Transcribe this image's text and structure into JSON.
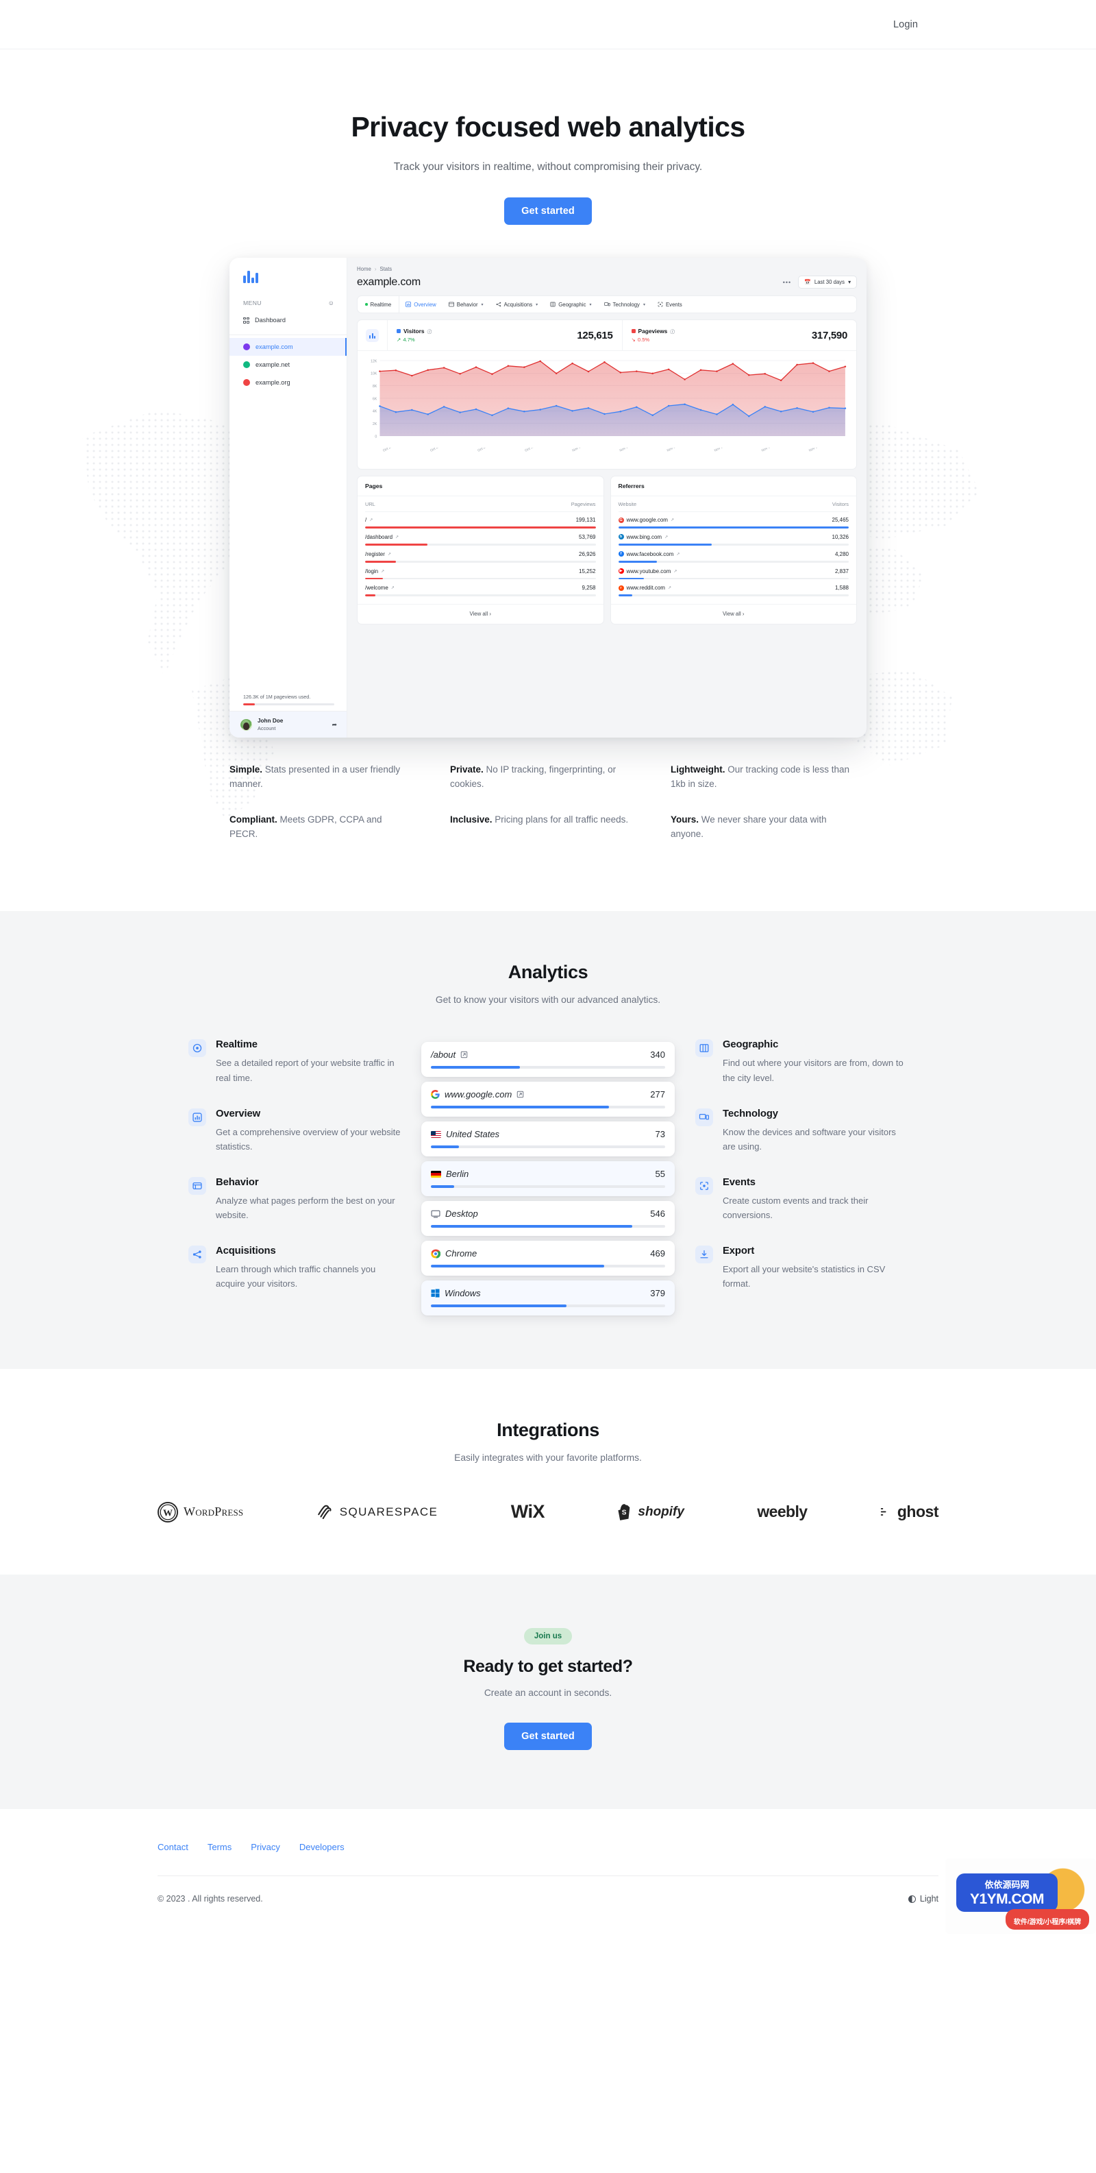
{
  "nav": {
    "login": "Login"
  },
  "hero": {
    "title": "Privacy focused web analytics",
    "subtitle": "Track your visitors in realtime, without compromising their privacy.",
    "cta": "Get started"
  },
  "dashboard": {
    "menu_label": "MENU",
    "nav_dashboard": "Dashboard",
    "sites": [
      {
        "name": "example.com",
        "active": true,
        "color": "#7c3aed"
      },
      {
        "name": "example.net",
        "active": false,
        "color": "#10b981"
      },
      {
        "name": "example.org",
        "active": false,
        "color": "#ef4444"
      }
    ],
    "quota_text": "126.3K of 1M pageviews used.",
    "account_name": "John Doe",
    "account_sub": "Account",
    "breadcrumb_home": "Home",
    "breadcrumb_current": "Stats",
    "site_title": "example.com",
    "dots": "•••",
    "date_range": "Last 30 days",
    "tabs": [
      {
        "label": "Realtime",
        "icon": "dot-green",
        "caret": false,
        "active": false
      },
      {
        "label": "Overview",
        "icon": "chart-icon",
        "caret": false,
        "active": true
      },
      {
        "label": "Behavior",
        "icon": "window-icon",
        "caret": true,
        "active": false
      },
      {
        "label": "Acquisitions",
        "icon": "share-icon",
        "caret": true,
        "active": false
      },
      {
        "label": "Geographic",
        "icon": "map-icon",
        "caret": true,
        "active": false
      },
      {
        "label": "Technology",
        "icon": "device-icon",
        "caret": true,
        "active": false
      },
      {
        "label": "Events",
        "icon": "target-icon",
        "caret": false,
        "active": false
      }
    ],
    "metrics": [
      {
        "name": "Visitors",
        "value": "125,615",
        "delta": "4.7%",
        "direction": "up",
        "color": "#3b82f6"
      },
      {
        "name": "Pageviews",
        "value": "317,590",
        "delta": "0.5%",
        "direction": "down",
        "color": "#ef4444"
      }
    ],
    "pages_card": {
      "title": "Pages",
      "col_label": "URL",
      "col_value": "Pageviews",
      "rows": [
        {
          "label": "/",
          "value": "199,131",
          "pct": 100
        },
        {
          "label": "/dashboard",
          "value": "53,769",
          "pct": 27
        },
        {
          "label": "/register",
          "value": "26,926",
          "pct": 13.5
        },
        {
          "label": "/login",
          "value": "15,252",
          "pct": 7.7
        },
        {
          "label": "/welcome",
          "value": "9,258",
          "pct": 4.6
        }
      ],
      "view_all": "View all"
    },
    "referrers_card": {
      "title": "Referrers",
      "col_label": "Website",
      "col_value": "Visitors",
      "rows": [
        {
          "label": "www.google.com",
          "value": "25,465",
          "pct": 100,
          "brand": "#ea4335",
          "letter": "G"
        },
        {
          "label": "www.bing.com",
          "value": "10,326",
          "pct": 40.5,
          "brand": "#0d7ec4",
          "letter": "b"
        },
        {
          "label": "www.facebook.com",
          "value": "4,280",
          "pct": 16.8,
          "brand": "#1877f2",
          "letter": "f"
        },
        {
          "label": "www.youtube.com",
          "value": "2,837",
          "pct": 11.1,
          "brand": "#ff0000",
          "letter": "▶"
        },
        {
          "label": "www.reddit.com",
          "value": "1,588",
          "pct": 6.2,
          "brand": "#ff4500",
          "letter": "r"
        }
      ],
      "view_all": "View all"
    },
    "chart_data": {
      "type": "area",
      "title": "",
      "xlabel": "",
      "ylabel": "",
      "ylim": [
        0,
        12000
      ],
      "yticks": [
        "0",
        "2K",
        "4K",
        "6K",
        "8K",
        "10K",
        "12K"
      ],
      "grid": true,
      "legend_position": "top",
      "x": [
        "Oct 22",
        "Oct 23",
        "Oct 24",
        "Oct 25",
        "Oct 26",
        "Oct 27",
        "Oct 28",
        "Oct 29",
        "Oct 30",
        "Oct 31",
        "Nov 1",
        "Nov 2",
        "Nov 3",
        "Nov 4",
        "Nov 5",
        "Nov 6",
        "Nov 7",
        "Nov 8",
        "Nov 9",
        "Nov 10",
        "Nov 11",
        "Nov 12",
        "Nov 13",
        "Nov 14",
        "Nov 15",
        "Nov 16",
        "Nov 17",
        "Nov 18",
        "Nov 19",
        "Nov 20"
      ],
      "xtick_labels": [
        "Oct 22",
        "Oct 25",
        "Oct 28",
        "Oct 31",
        "Nov 3",
        "Nov 6",
        "Nov 9",
        "Nov 12",
        "Nov 15",
        "Nov 18"
      ],
      "series": [
        {
          "name": "Pageviews",
          "color": "#e03131",
          "values": [
            10300,
            10450,
            9600,
            10500,
            10850,
            9900,
            10950,
            9850,
            11150,
            10950,
            11900,
            9950,
            11550,
            10250,
            11750,
            10100,
            10300,
            9950,
            10600,
            9000,
            10500,
            10300,
            11500,
            9700,
            9900,
            8850,
            11350,
            11600,
            10300,
            11050
          ]
        },
        {
          "name": "Visitors",
          "color": "#3b82f6",
          "values": [
            4750,
            3800,
            4150,
            3450,
            4650,
            3750,
            4250,
            3300,
            4400,
            3900,
            4200,
            4800,
            4000,
            4450,
            3500,
            3900,
            4600,
            3300,
            4800,
            5050,
            4150,
            3450,
            5000,
            3150,
            4650,
            3900,
            4450,
            3850,
            4500,
            4400
          ]
        }
      ]
    }
  },
  "blurbs": [
    {
      "lead": "Simple.",
      "text": " Stats presented in a user friendly manner."
    },
    {
      "lead": "Private.",
      "text": " No IP tracking, fingerprinting, or cookies."
    },
    {
      "lead": "Lightweight.",
      "text": " Our tracking code is less than 1kb in size."
    },
    {
      "lead": "Compliant.",
      "text": " Meets GDPR, CCPA and PECR."
    },
    {
      "lead": "Inclusive.",
      "text": " Pricing plans for all traffic needs."
    },
    {
      "lead": "Yours.",
      "text": " We never share your data with anyone."
    }
  ],
  "analytics": {
    "title": "Analytics",
    "subtitle": "Get to know your visitors with our advanced analytics.",
    "left_features": [
      {
        "icon": "realtime-icon",
        "title": "Realtime",
        "desc": "See a detailed report of your website traffic in real time."
      },
      {
        "icon": "overview-icon",
        "title": "Overview",
        "desc": "Get a comprehensive overview of your website statistics."
      },
      {
        "icon": "behavior-icon",
        "title": "Behavior",
        "desc": "Analyze what pages perform the best on your website."
      },
      {
        "icon": "acquisitions-icon",
        "title": "Acquisitions",
        "desc": "Learn through which traffic channels you acquire your visitors."
      }
    ],
    "right_features": [
      {
        "icon": "geographic-icon",
        "title": "Geographic",
        "desc": "Find out where your visitors are from, down to the city level."
      },
      {
        "icon": "technology-icon",
        "title": "Technology",
        "desc": "Know the devices and software your visitors are using."
      },
      {
        "icon": "events-icon",
        "title": "Events",
        "desc": "Create custom events and track their conversions."
      },
      {
        "icon": "export-icon",
        "title": "Export",
        "desc": "Export all your website's statistics in CSV format."
      }
    ],
    "stat_cards": [
      {
        "label": "/about",
        "value": "340",
        "pct": 38,
        "icon": "external-link-icon",
        "alt": false
      },
      {
        "label": "www.google.com",
        "value": "277",
        "pct": 76,
        "icon": "google-icon",
        "alt": false
      },
      {
        "label": "United States",
        "value": "73",
        "pct": 12,
        "icon": "flag-us-icon",
        "alt": false
      },
      {
        "label": "Berlin",
        "value": "55",
        "pct": 10,
        "icon": "flag-de-icon",
        "alt": true
      },
      {
        "label": "Desktop",
        "value": "546",
        "pct": 86,
        "icon": "monitor-icon",
        "alt": false
      },
      {
        "label": "Chrome",
        "value": "469",
        "pct": 74,
        "icon": "chrome-icon",
        "alt": false
      },
      {
        "label": "Windows",
        "value": "379",
        "pct": 58,
        "icon": "windows-icon",
        "alt": true
      }
    ]
  },
  "integrations": {
    "title": "Integrations",
    "subtitle": "Easily integrates with your favorite platforms.",
    "logos": [
      {
        "name": "WordPress",
        "id": "wordpress-logo"
      },
      {
        "name": "SQUARESPACE",
        "id": "squarespace-logo"
      },
      {
        "name": "WiX",
        "id": "wix-logo"
      },
      {
        "name": "shopify",
        "id": "shopify-logo"
      },
      {
        "name": "weebly",
        "id": "weebly-logo"
      },
      {
        "name": "ghost",
        "id": "ghost-logo"
      }
    ]
  },
  "cta": {
    "pill": "Join us",
    "title": "Ready to get started?",
    "subtitle": "Create an account in seconds.",
    "button": "Get started"
  },
  "footer": {
    "links": [
      "Contact",
      "Terms",
      "Privacy",
      "Developers"
    ],
    "copyright": "© 2023 . All rights reserved.",
    "theme": "Light"
  },
  "watermark": {
    "cn": "依依源码网",
    "domain": "Y1YM.COM",
    "sub": "软件/游戏/小程序/棋牌"
  },
  "colors": {
    "accent": "#3b82f6",
    "danger": "#ef4444",
    "success": "#16a34a",
    "gray_bg": "#f4f5f6"
  }
}
